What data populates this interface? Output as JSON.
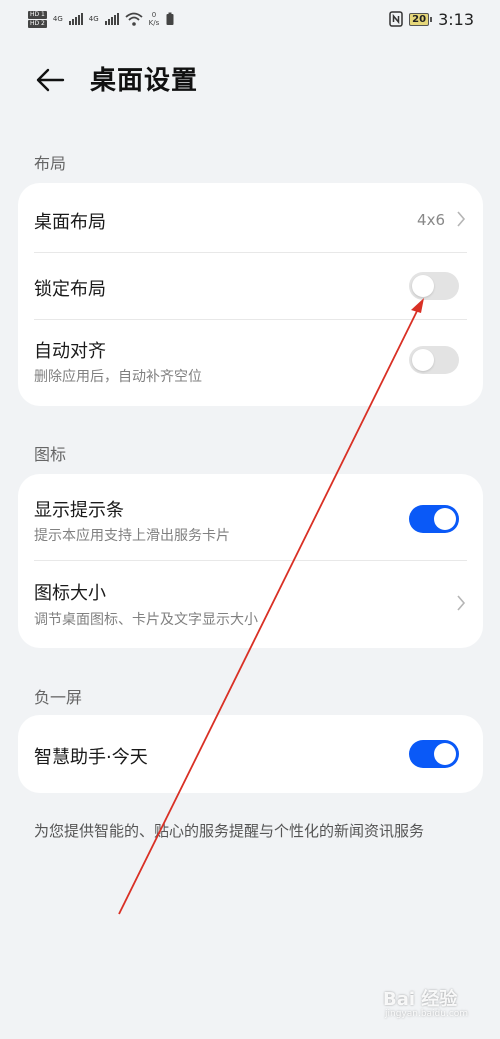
{
  "status_bar": {
    "sim1": "HD 1",
    "sim2": "HD 2",
    "network_type_1": "4G",
    "network_type_2": "4G",
    "net_speed_value": "0",
    "net_speed_unit": "K/s",
    "battery": "20",
    "time": "3:13"
  },
  "header": {
    "title": "桌面设置"
  },
  "sections": {
    "layout": {
      "label": "布局",
      "desktop_layout": {
        "title": "桌面布局",
        "value": "4x6"
      },
      "lock_layout": {
        "title": "锁定布局",
        "enabled": false
      },
      "auto_align": {
        "title": "自动对齐",
        "subtitle": "删除应用后，自动补齐空位",
        "enabled": false
      }
    },
    "icons": {
      "label": "图标",
      "show_hint_bar": {
        "title": "显示提示条",
        "subtitle": "提示本应用支持上滑出服务卡片",
        "enabled": true
      },
      "icon_size": {
        "title": "图标大小",
        "subtitle": "调节桌面图标、卡片及文字显示大小"
      }
    },
    "minus_one": {
      "label": "负一屏",
      "smart_assistant": {
        "title": "智慧助手·今天",
        "enabled": true
      }
    }
  },
  "footer": {
    "text": "为您提供智能的、贴心的服务提醒与个性化的新闻资讯服务"
  },
  "watermark": {
    "main": "Bai 经验",
    "sub": "jingyan.baidu.com"
  },
  "colors": {
    "accent": "#0a59f7",
    "annotation": "#d93025"
  }
}
